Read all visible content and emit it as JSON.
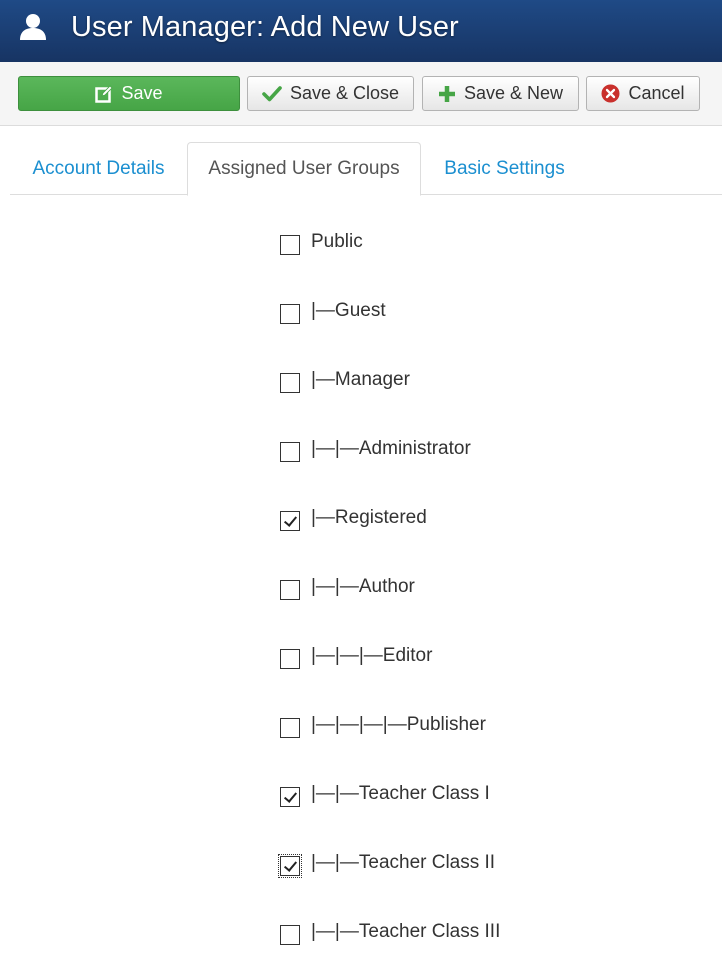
{
  "header": {
    "title": "User Manager: Add New User",
    "icon": "user-icon",
    "background": "#1a3867"
  },
  "toolbar": {
    "save_label": "Save",
    "save_close_label": "Save & Close",
    "save_new_label": "Save & New",
    "cancel_label": "Cancel",
    "save_color": "#5bb75b",
    "cancel_icon_color": "#c9302c",
    "check_icon_color": "#46a546"
  },
  "tabs": [
    {
      "label": "Account Details",
      "active": false
    },
    {
      "label": "Assigned User Groups",
      "active": true
    },
    {
      "label": "Basic Settings",
      "active": false
    }
  ],
  "groups": [
    {
      "label": "Public",
      "checked": false
    },
    {
      "label": "|—Guest",
      "checked": false
    },
    {
      "label": "|—Manager",
      "checked": false
    },
    {
      "label": "|—|—Administrator",
      "checked": false
    },
    {
      "label": "|—Registered",
      "checked": true
    },
    {
      "label": "|—|—Author",
      "checked": false
    },
    {
      "label": "|—|—|—Editor",
      "checked": false
    },
    {
      "label": "|—|—|—|—Publisher",
      "checked": false
    },
    {
      "label": "|—|—Teacher Class I",
      "checked": true
    },
    {
      "label": "|—|—Teacher Class II",
      "checked": true,
      "focused": true
    },
    {
      "label": "|—|—Teacher Class III",
      "checked": false
    }
  ]
}
